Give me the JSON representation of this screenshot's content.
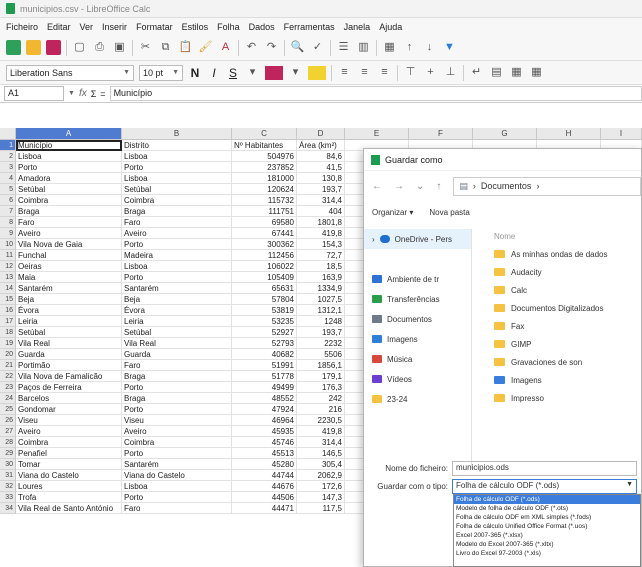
{
  "window": {
    "title": "municipios.csv - LibreOffice Calc"
  },
  "menu": [
    "Ficheiro",
    "Editar",
    "Ver",
    "Inserir",
    "Formatar",
    "Estilos",
    "Folha",
    "Dados",
    "Ferramentas",
    "Janela",
    "Ajuda"
  ],
  "format": {
    "font_name": "Liberation Sans",
    "font_size": "10 pt",
    "bold": "N",
    "italic": "I",
    "underline": "S"
  },
  "formula": {
    "cell_ref": "A1",
    "fx": "fx",
    "sum": "Σ",
    "equals": "=",
    "content": "Município"
  },
  "columns": [
    "A",
    "B",
    "C",
    "D",
    "E",
    "F",
    "G",
    "H",
    "I"
  ],
  "rows": [
    {
      "n": "1",
      "a": "Município",
      "b": "Distrito",
      "c": "Nº Habitantes",
      "d": "Área (km²)"
    },
    {
      "n": "2",
      "a": "Lisboa",
      "b": "Lisboa",
      "c": "504976",
      "d": "84,6"
    },
    {
      "n": "3",
      "a": "Porto",
      "b": "Porto",
      "c": "237852",
      "d": "41,5"
    },
    {
      "n": "4",
      "a": "Amadora",
      "b": "Lisboa",
      "c": "181000",
      "d": "130,8"
    },
    {
      "n": "5",
      "a": "Setúbal",
      "b": "Setúbal",
      "c": "120624",
      "d": "193,7"
    },
    {
      "n": "6",
      "a": "Coimbra",
      "b": "Coimbra",
      "c": "115732",
      "d": "314,4"
    },
    {
      "n": "7",
      "a": "Braga",
      "b": "Braga",
      "c": "111751",
      "d": "404"
    },
    {
      "n": "8",
      "a": "Faro",
      "b": "Faro",
      "c": "69580",
      "d": "1801,8"
    },
    {
      "n": "9",
      "a": "Aveiro",
      "b": "Aveiro",
      "c": "67441",
      "d": "419,8"
    },
    {
      "n": "10",
      "a": "Vila Nova de Gaia",
      "b": "Porto",
      "c": "300362",
      "d": "154,3"
    },
    {
      "n": "11",
      "a": "Funchal",
      "b": "Madeira",
      "c": "112456",
      "d": "72,7"
    },
    {
      "n": "12",
      "a": "Oeiras",
      "b": "Lisboa",
      "c": "106022",
      "d": "18,5"
    },
    {
      "n": "13",
      "a": "Maia",
      "b": "Porto",
      "c": "105409",
      "d": "163,9"
    },
    {
      "n": "14",
      "a": "Santarém",
      "b": "Santarém",
      "c": "65631",
      "d": "1334,9"
    },
    {
      "n": "15",
      "a": "Beja",
      "b": "Beja",
      "c": "57804",
      "d": "1027,5"
    },
    {
      "n": "16",
      "a": "Évora",
      "b": "Évora",
      "c": "53819",
      "d": "1312,1"
    },
    {
      "n": "17",
      "a": "Leiria",
      "b": "Leiria",
      "c": "53235",
      "d": "1248"
    },
    {
      "n": "18",
      "a": "Setúbal",
      "b": "Setúbal",
      "c": "52927",
      "d": "193,7"
    },
    {
      "n": "19",
      "a": "Vila Real",
      "b": "Vila Real",
      "c": "52793",
      "d": "2232"
    },
    {
      "n": "20",
      "a": "Guarda",
      "b": "Guarda",
      "c": "40682",
      "d": "5506"
    },
    {
      "n": "21",
      "a": "Portimão",
      "b": "Faro",
      "c": "51991",
      "d": "1856,1"
    },
    {
      "n": "22",
      "a": "Vila Nova de Famalicão",
      "b": "Braga",
      "c": "51778",
      "d": "179,1"
    },
    {
      "n": "23",
      "a": "Paços de Ferreira",
      "b": "Porto",
      "c": "49499",
      "d": "176,3"
    },
    {
      "n": "24",
      "a": "Barcelos",
      "b": "Braga",
      "c": "48552",
      "d": "242"
    },
    {
      "n": "25",
      "a": "Gondomar",
      "b": "Porto",
      "c": "47924",
      "d": "216"
    },
    {
      "n": "26",
      "a": "Viseu",
      "b": "Viseu",
      "c": "46964",
      "d": "2230,5"
    },
    {
      "n": "27",
      "a": "Aveiro",
      "b": "Aveiro",
      "c": "45935",
      "d": "419,8"
    },
    {
      "n": "28",
      "a": "Coimbra",
      "b": "Coimbra",
      "c": "45746",
      "d": "314,4"
    },
    {
      "n": "29",
      "a": "Penafiel",
      "b": "Porto",
      "c": "45513",
      "d": "146,5"
    },
    {
      "n": "30",
      "a": "Tomar",
      "b": "Santarém",
      "c": "45280",
      "d": "305,4"
    },
    {
      "n": "31",
      "a": "Viana do Castelo",
      "b": "Viana do Castelo",
      "c": "44744",
      "d": "2062,9"
    },
    {
      "n": "32",
      "a": "Loures",
      "b": "Lisboa",
      "c": "44676",
      "d": "172,6"
    },
    {
      "n": "33",
      "a": "Trofa",
      "b": "Porto",
      "c": "44506",
      "d": "147,3"
    },
    {
      "n": "34",
      "a": "Vila Real de Santo António",
      "b": "Faro",
      "c": "44471",
      "d": "117,5"
    }
  ],
  "dialog": {
    "title": "Guardar como",
    "address": "Documentos",
    "organize": "Organizar ▾",
    "new_folder": "Nova pasta",
    "nav": [
      {
        "label": "OneDrive - Pers",
        "icon": "cloud-icon",
        "color": "#1f6fd0"
      },
      {
        "label": "Ambiente de tr",
        "icon": "desktop-icon",
        "color": "#2b74d6"
      },
      {
        "label": "Transferências",
        "icon": "download-icon",
        "color": "#2a9d4a"
      },
      {
        "label": "Documentos",
        "icon": "documents-icon",
        "color": "#6c7a89"
      },
      {
        "label": "Imagens",
        "icon": "pictures-icon",
        "color": "#2f7fd8"
      },
      {
        "label": "Música",
        "icon": "music-icon",
        "color": "#d8473b"
      },
      {
        "label": "Vídeos",
        "icon": "videos-icon",
        "color": "#6d3fd1"
      },
      {
        "label": "23-24",
        "icon": "folder-icon",
        "color": "#f5c242"
      }
    ],
    "column_header": "Nome",
    "files": [
      {
        "label": "As minhas ondas de dados",
        "blue": false
      },
      {
        "label": "Audacity",
        "blue": false
      },
      {
        "label": "Calc",
        "blue": false
      },
      {
        "label": "Documentos Digitalizados",
        "blue": false
      },
      {
        "label": "Fax",
        "blue": false
      },
      {
        "label": "GIMP",
        "blue": false
      },
      {
        "label": "Gravaciones de son",
        "blue": false
      },
      {
        "label": "Imagens",
        "blue": true
      },
      {
        "label": "Impresso",
        "blue": false
      }
    ],
    "filename_label": "Nome do ficheiro:",
    "filename_value": "municipios.ods",
    "type_label": "Guardar com o tipo:",
    "type_value": "Folha de cálculo ODF (*.ods)",
    "type_options": [
      "Folha de cálculo ODF (*.ods)",
      "Modelo de folha de cálculo ODF (*.ots)",
      "Folha de cálculo ODF em XML simples (*.fods)",
      "Folha de cálculo Unified Office Format (*.uos)",
      "Excel 2007-365 (*.xlsx)",
      "Modelo do Excel 2007-365 (*.xltx)",
      "Livro do Excel 97-2003 (*.xls)"
    ]
  }
}
